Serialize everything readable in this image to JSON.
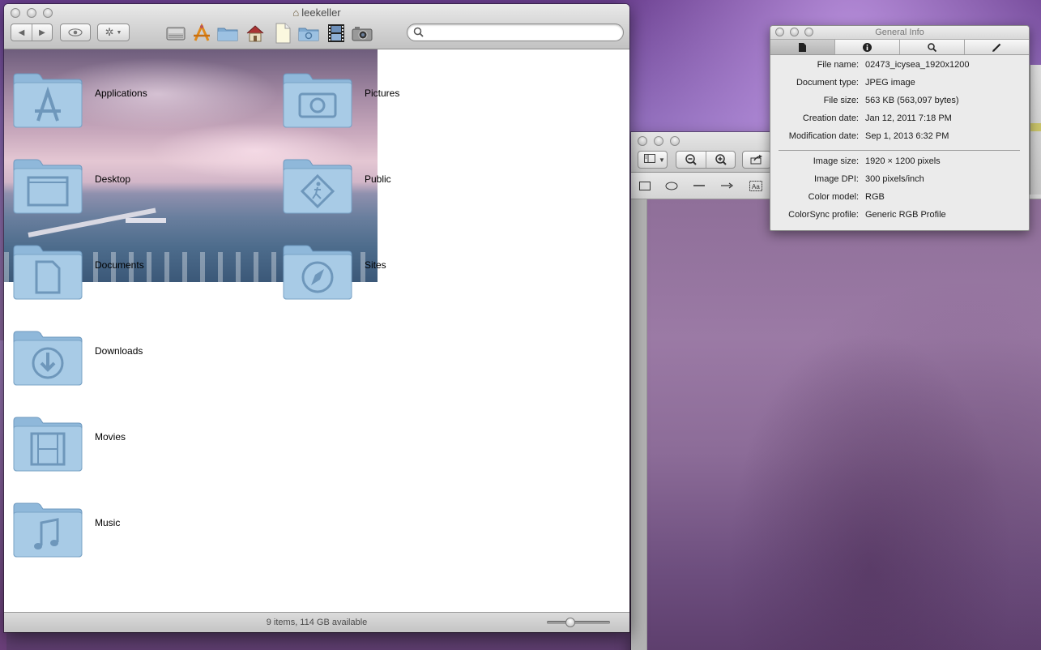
{
  "finder": {
    "title": "leekeller",
    "toolbar": {
      "back_label": "◀",
      "forward_label": "▶",
      "search_placeholder": "",
      "search_value": ""
    },
    "items": [
      {
        "label": "Applications",
        "icon": "app-store-folder-icon"
      },
      {
        "label": "Desktop",
        "icon": "desktop-folder-icon"
      },
      {
        "label": "Documents",
        "icon": "documents-folder-icon"
      },
      {
        "label": "Downloads",
        "icon": "downloads-folder-icon"
      },
      {
        "label": "Movies",
        "icon": "movies-folder-icon"
      },
      {
        "label": "Music",
        "icon": "music-folder-icon"
      },
      {
        "label": "Pictures",
        "icon": "pictures-folder-icon"
      },
      {
        "label": "Public",
        "icon": "public-folder-icon"
      },
      {
        "label": "Sites",
        "icon": "sites-folder-icon"
      }
    ],
    "status": "9 items, 114 GB available",
    "icon_size_fraction": 0.35
  },
  "info_panel": {
    "title": "General Info",
    "tabs": [
      "file-icon",
      "info-icon",
      "search-icon",
      "pencil-icon"
    ],
    "rows": [
      {
        "key": "File name:",
        "value": "02473_icysea_1920x1200"
      },
      {
        "key": "Document type:",
        "value": "JPEG image"
      },
      {
        "key": "File size:",
        "value": "563 KB (563,097 bytes)"
      },
      {
        "key": "Creation date:",
        "value": "Jan 12, 2011 7:18 PM"
      },
      {
        "key": "Modification date:",
        "value": "Sep 1, 2013 6:32 PM"
      }
    ],
    "image_rows": [
      {
        "key": "Image size:",
        "value": "1920 × 1200 pixels"
      },
      {
        "key": "Image DPI:",
        "value": "300 pixels/inch"
      },
      {
        "key": "Color model:",
        "value": "RGB"
      },
      {
        "key": "ColorSync profile:",
        "value": "Generic RGB Profile"
      }
    ]
  },
  "colors": {
    "folder_light": "#a9cde6",
    "folder_dark": "#6f9cc0",
    "desktop_accent": "#8a67b5"
  }
}
